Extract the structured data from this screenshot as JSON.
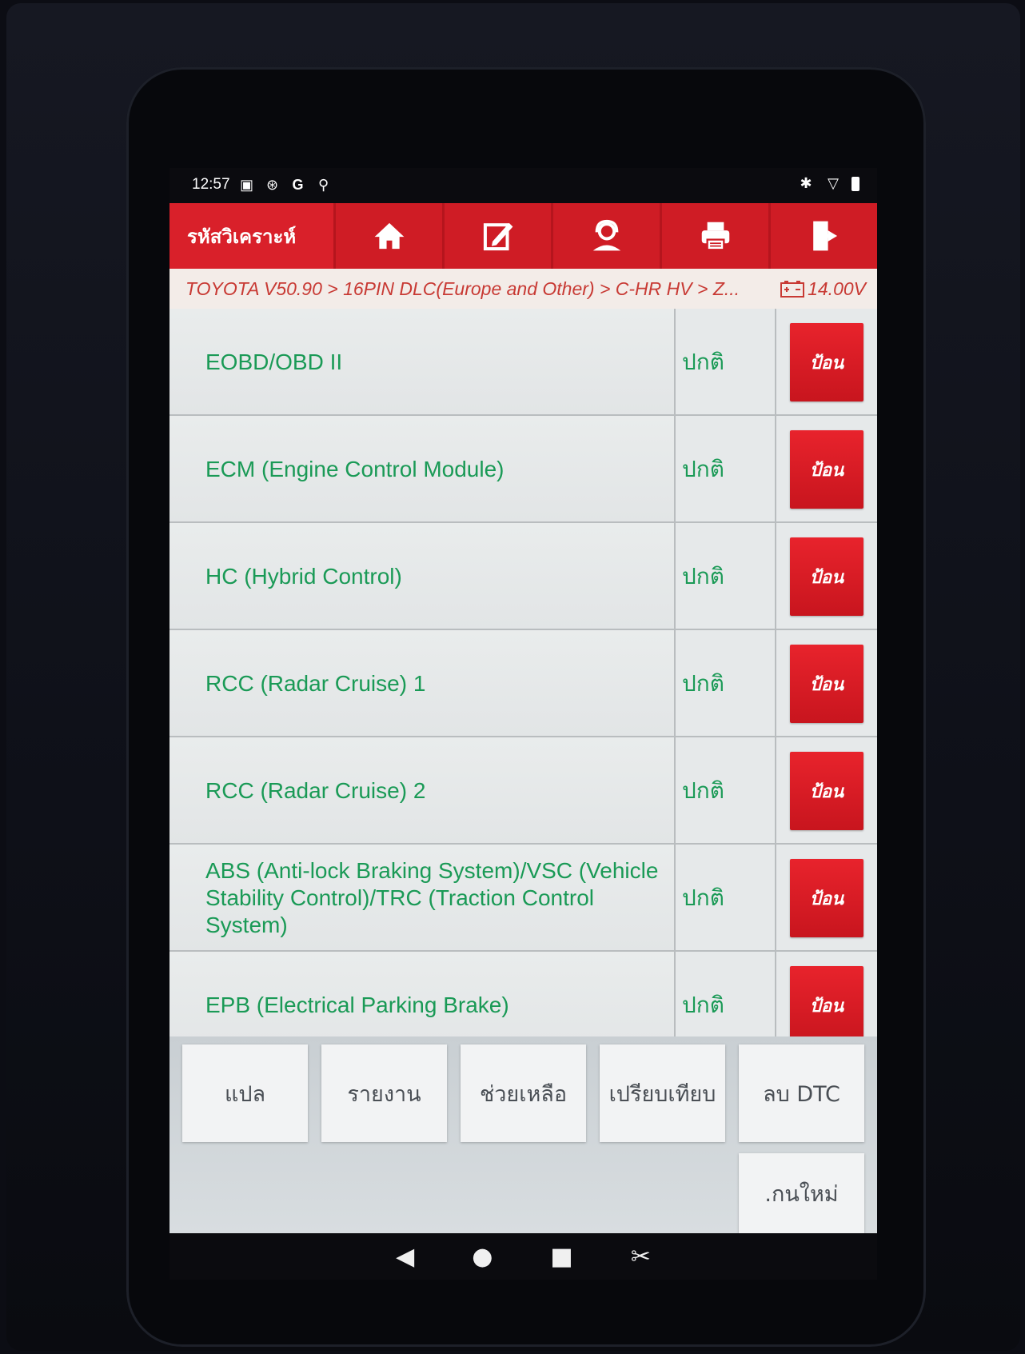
{
  "statusbar": {
    "time": "12:57",
    "icons_left": [
      "image-icon",
      "accessibility-icon",
      "google-icon",
      "usb-icon"
    ],
    "icons_right": [
      "bluetooth-icon",
      "wifi-icon",
      "battery-icon"
    ]
  },
  "toolbar": {
    "title": "รหัสวิเคราะห์",
    "buttons": [
      "home-icon",
      "edit-icon",
      "support-icon",
      "print-icon",
      "exit-icon"
    ]
  },
  "breadcrumb": {
    "path": "TOYOTA V50.90 > 16PIN DLC(Europe and Other) > C-HR HV > Z...",
    "voltage": "14.00V"
  },
  "systems": [
    {
      "name": "EOBD/OBD II",
      "status": "ปกติ",
      "button": "ป้อน"
    },
    {
      "name": "ECM (Engine Control Module)",
      "status": "ปกติ",
      "button": "ป้อน"
    },
    {
      "name": "HC (Hybrid Control)",
      "status": "ปกติ",
      "button": "ป้อน"
    },
    {
      "name": "RCC (Radar Cruise) 1",
      "status": "ปกติ",
      "button": "ป้อน"
    },
    {
      "name": "RCC (Radar Cruise) 2",
      "status": "ปกติ",
      "button": "ป้อน"
    },
    {
      "name": "ABS (Anti-lock Braking System)/VSC (Vehicle Stability Control)/TRC (Traction Control System)",
      "status": "ปกติ",
      "button": "ป้อน"
    },
    {
      "name": "EPB (Electrical Parking Brake)",
      "status": "ปกติ",
      "button": "ป้อน"
    }
  ],
  "footer": {
    "translate": "แปล",
    "report": "รายงาน",
    "help": "ช่วยเหลือ",
    "compare": "เปรียบเทียบ",
    "clear_dtc": "ลบ DTC",
    "rescan": ".กนใหม่"
  },
  "colors": {
    "accent_red": "#d9202a",
    "text_green": "#1a9a56",
    "crumb_red": "#c83a34"
  }
}
